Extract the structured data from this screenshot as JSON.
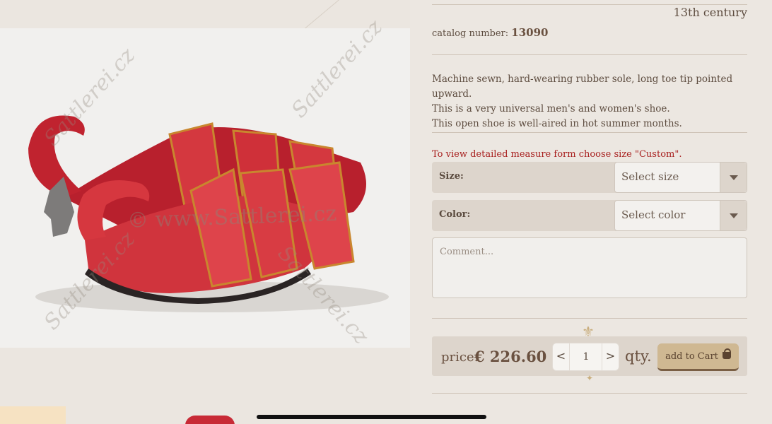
{
  "product": {
    "century": "13th century",
    "catalog_label": "catalog number:",
    "catalog_number": "13090",
    "description": [
      "Machine sewn, hard-wearing rubber sole, long toe tip pointed upward.",
      "This is a very universal men's and women's shoe.",
      "This open shoe is well-aired in hot summer months."
    ],
    "image_watermark": "© www.Sattlerei.cz",
    "watermark_text": "Sattlerei.cz"
  },
  "options": {
    "note": "To view detailed measure form choose size \"Custom\".",
    "size_label": "Size:",
    "size_value": "Select size",
    "color_label": "Color:",
    "color_value": "Select color",
    "comment_placeholder": "Comment..."
  },
  "purchase": {
    "price_label": "price:",
    "price_value": "€  226.60",
    "quantity": "1",
    "qty_label": "qty.",
    "dec_symbol": "<",
    "inc_symbol": ">",
    "add_to_cart_label": "add to Cart"
  },
  "colors": {
    "background": "#ece7e1",
    "shoe_red": "#c82a36",
    "accent_gold": "#cfb892",
    "note_red": "#a8201f"
  }
}
